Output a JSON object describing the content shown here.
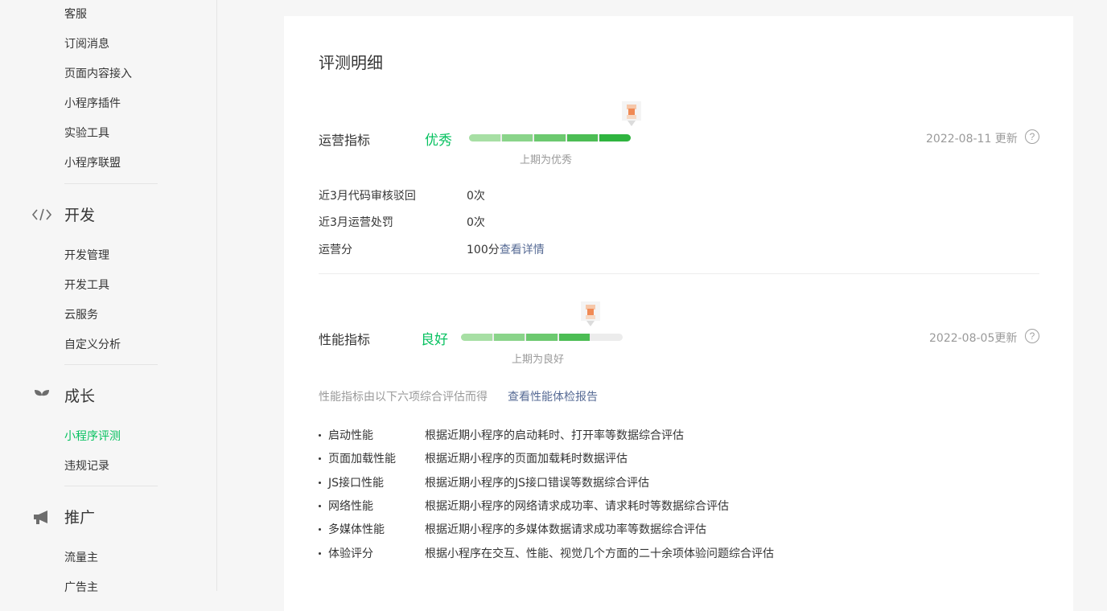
{
  "sidebar": {
    "top_items": [
      "客服",
      "订阅消息",
      "页面内容接入",
      "小程序插件",
      "实验工具",
      "小程序联盟"
    ],
    "groups": [
      {
        "label": "开发",
        "icon": "code-icon",
        "items": [
          "开发管理",
          "开发工具",
          "云服务",
          "自定义分析"
        ]
      },
      {
        "label": "成长",
        "icon": "sprout-icon",
        "items": [
          "小程序评测",
          "违规记录"
        ]
      },
      {
        "label": "推广",
        "icon": "megaphone-icon",
        "items": [
          "流量主",
          "广告主"
        ]
      }
    ],
    "active_item": "小程序评测"
  },
  "main": {
    "title": "评测明细",
    "operations": {
      "label": "运营指标",
      "grade": "优秀",
      "level": 5,
      "max_level": 5,
      "last_period": "上期为优秀",
      "date": "2022-08-11 更新",
      "help": "?",
      "rows": [
        {
          "label": "近3月代码审核驳回",
          "value": "0次"
        },
        {
          "label": "近3月运营处罚",
          "value": "0次"
        },
        {
          "label": "运营分",
          "value": "100分",
          "link": "查看详情"
        }
      ]
    },
    "performance": {
      "label": "性能指标",
      "grade": "良好",
      "level": 4,
      "max_level": 5,
      "last_period": "上期为良好",
      "date": "2022-08-05更新",
      "help": "?",
      "intro": "性能指标由以下六项综合评估而得",
      "intro_link": "查看性能体检报告",
      "items": [
        {
          "name": "启动性能",
          "desc": "根据近期小程序的启动耗时、打开率等数据综合评估"
        },
        {
          "name": "页面加载性能",
          "desc": "根据近期小程序的页面加载耗时数据评估"
        },
        {
          "name": "JS接口性能",
          "desc": "根据近期小程序的JS接口错误等数据综合评估"
        },
        {
          "name": "网络性能",
          "desc": "根据近期小程序的网络请求成功率、请求耗时等数据综合评估"
        },
        {
          "name": "多媒体性能",
          "desc": "根据近期小程序的多媒体数据请求成功率等数据综合评估"
        },
        {
          "name": "体验评分",
          "desc": "根据小程序在交互、性能、视觉几个方面的二十余项体验问题综合评估"
        }
      ]
    },
    "colors": {
      "accent": "#07c160",
      "link": "#576b95",
      "muted": "#9a9a9a"
    }
  }
}
